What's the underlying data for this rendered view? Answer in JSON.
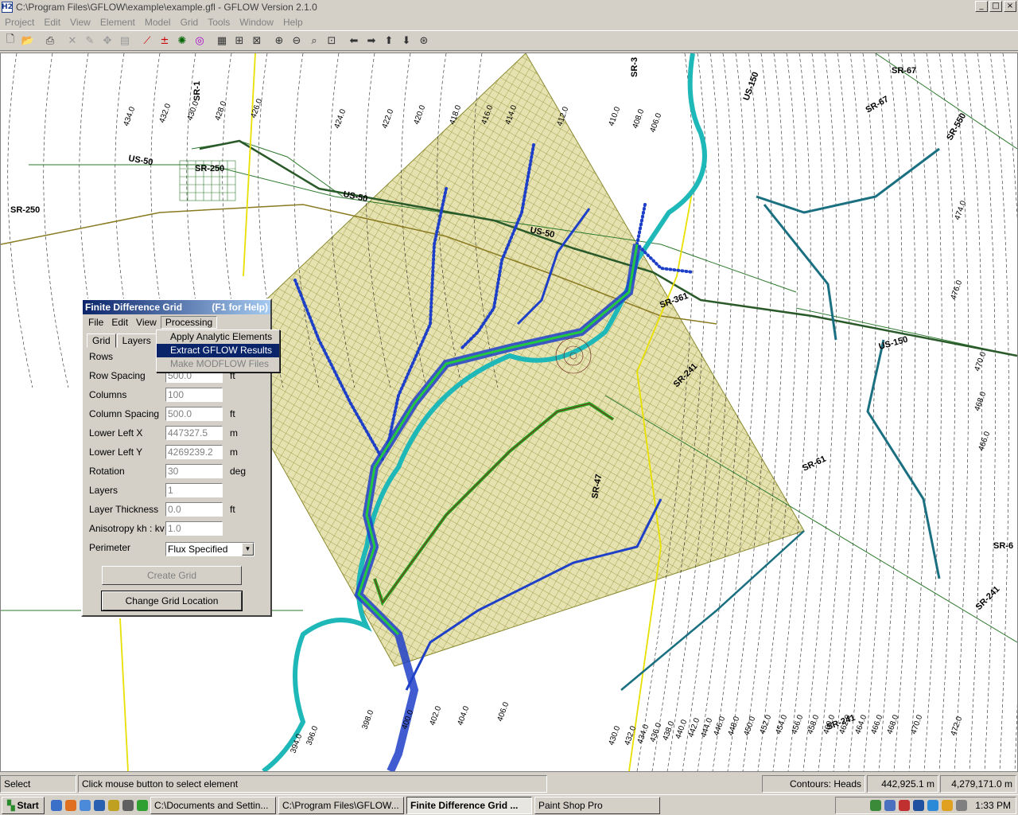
{
  "window": {
    "title": "C:\\Program Files\\GFLOW\\example\\example.gfl - GFLOW Version 2.1.0",
    "icon_text": "H2"
  },
  "menubar": [
    "Project",
    "Edit",
    "View",
    "Element",
    "Model",
    "Grid",
    "Tools",
    "Window",
    "Help"
  ],
  "toolbar_icons": [
    "new-icon",
    "open-icon",
    "print-icon",
    "delete-icon",
    "edit-icon",
    "move-icon",
    "properties-icon",
    "line-sink-icon",
    "well-icon",
    "pond-icon",
    "inhomogeneity-icon",
    "grid-icon",
    "calculate-icon",
    "contour-icon",
    "trace-icon",
    "view-icon",
    "zoom-in-icon",
    "zoom-out-icon",
    "zoom-window-icon",
    "zoom-extents-icon",
    "pan-left-icon",
    "pan-right-icon",
    "pan-up-icon",
    "pan-down-icon",
    "center-icon"
  ],
  "map": {
    "road_labels": [
      "SR-1",
      "SR-3",
      "US-50",
      "US-50",
      "US-50",
      "SR-250",
      "SR-250",
      "SR-67",
      "SR-67",
      "SR-550",
      "US-150",
      "US-150",
      "SR-61",
      "SR-6",
      "SR-241",
      "SR-241",
      "SR-47",
      "SR-241",
      "SR-361"
    ],
    "contour_labels": [
      "434.0",
      "432.0",
      "430.0",
      "428.0",
      "426.0",
      "424.0",
      "422.0",
      "420.0",
      "418.0",
      "416.0",
      "414.0",
      "412.0",
      "410.0",
      "408.0",
      "406.0",
      "474.0",
      "476.0",
      "470.0",
      "468.0",
      "466.0",
      "394.0",
      "396.0",
      "398.0",
      "400.0",
      "402.0",
      "404.0",
      "406.0",
      "430.0",
      "432.0",
      "434.0",
      "436.0",
      "438.0",
      "440.0",
      "442.0",
      "444.0",
      "446.0",
      "448.0",
      "450.0",
      "452.0",
      "454.0",
      "456.0",
      "458.0",
      "460.0",
      "462.0",
      "464.0",
      "466.0",
      "468.0",
      "470.0",
      "472.0"
    ]
  },
  "dialog": {
    "title": "Finite Difference Grid",
    "help": "(F1 for Help)",
    "menu": [
      "File",
      "Edit",
      "View",
      "Processing"
    ],
    "tabs": [
      "Grid",
      "Layers"
    ],
    "fields": [
      {
        "label": "Rows",
        "value": "",
        "unit": ""
      },
      {
        "label": "Row Spacing",
        "value": "500.0",
        "unit": "ft"
      },
      {
        "label": "Columns",
        "value": "100",
        "unit": ""
      },
      {
        "label": "Column Spacing",
        "value": "500.0",
        "unit": "ft"
      },
      {
        "label": "Lower Left X",
        "value": "447327.5",
        "unit": "m"
      },
      {
        "label": "Lower Left Y",
        "value": "4269239.2",
        "unit": "m"
      },
      {
        "label": "Rotation",
        "value": "30",
        "unit": "deg"
      },
      {
        "label": "Layers",
        "value": "1",
        "unit": ""
      },
      {
        "label": "Layer Thickness",
        "value": "0.0",
        "unit": "ft"
      },
      {
        "label": "Anisotropy  kh : kv",
        "value": "1.0",
        "unit": ""
      }
    ],
    "perimeter_label": "Perimeter",
    "perimeter_value": "Flux Specified",
    "create_grid": "Create Grid",
    "change_location": "Change Grid Location"
  },
  "processing_menu": [
    "Apply Analytic Elements",
    "Extract GFLOW Results",
    "Make MODFLOW Files"
  ],
  "status": {
    "mode": "Select",
    "hint": "Click mouse button to select element",
    "contours": "Contours: Heads",
    "x": "442,925.1 m",
    "y": "4,279,171.0 m"
  },
  "taskbar": {
    "start": "Start",
    "tasks": [
      "C:\\Documents and Settin...",
      "C:\\Program Files\\GFLOW...",
      "Finite Difference Grid ...",
      "Paint Shop Pro"
    ],
    "clock": "1:33 PM"
  },
  "colors": {
    "river": "#0000c8",
    "riverfill": "#1fb8b8",
    "grid": "#8a8a30",
    "gridfill": "#e0dca8",
    "roads": "#2e7a2e",
    "highlight": "#0a246a"
  }
}
